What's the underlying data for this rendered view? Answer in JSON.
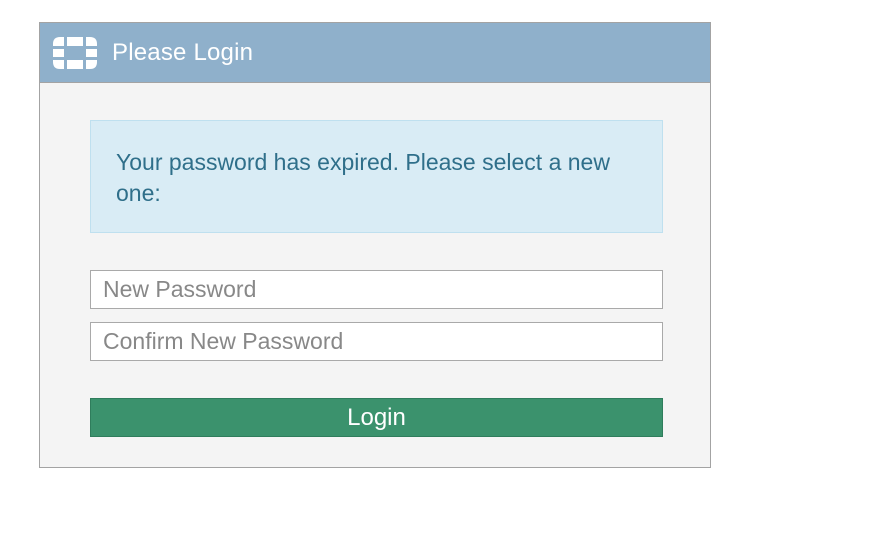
{
  "header": {
    "title": "Please Login",
    "logo_icon": "fortinet-logo-icon",
    "background_color": "#8fb0cb"
  },
  "alert": {
    "message": "Your password has expired. Please select a new one:",
    "background_color": "#d9ecf5",
    "text_color": "#2f6f8a"
  },
  "form": {
    "new_password_placeholder": "New Password",
    "confirm_password_placeholder": "Confirm New Password",
    "login_label": "Login",
    "button_color": "#3b926d"
  }
}
